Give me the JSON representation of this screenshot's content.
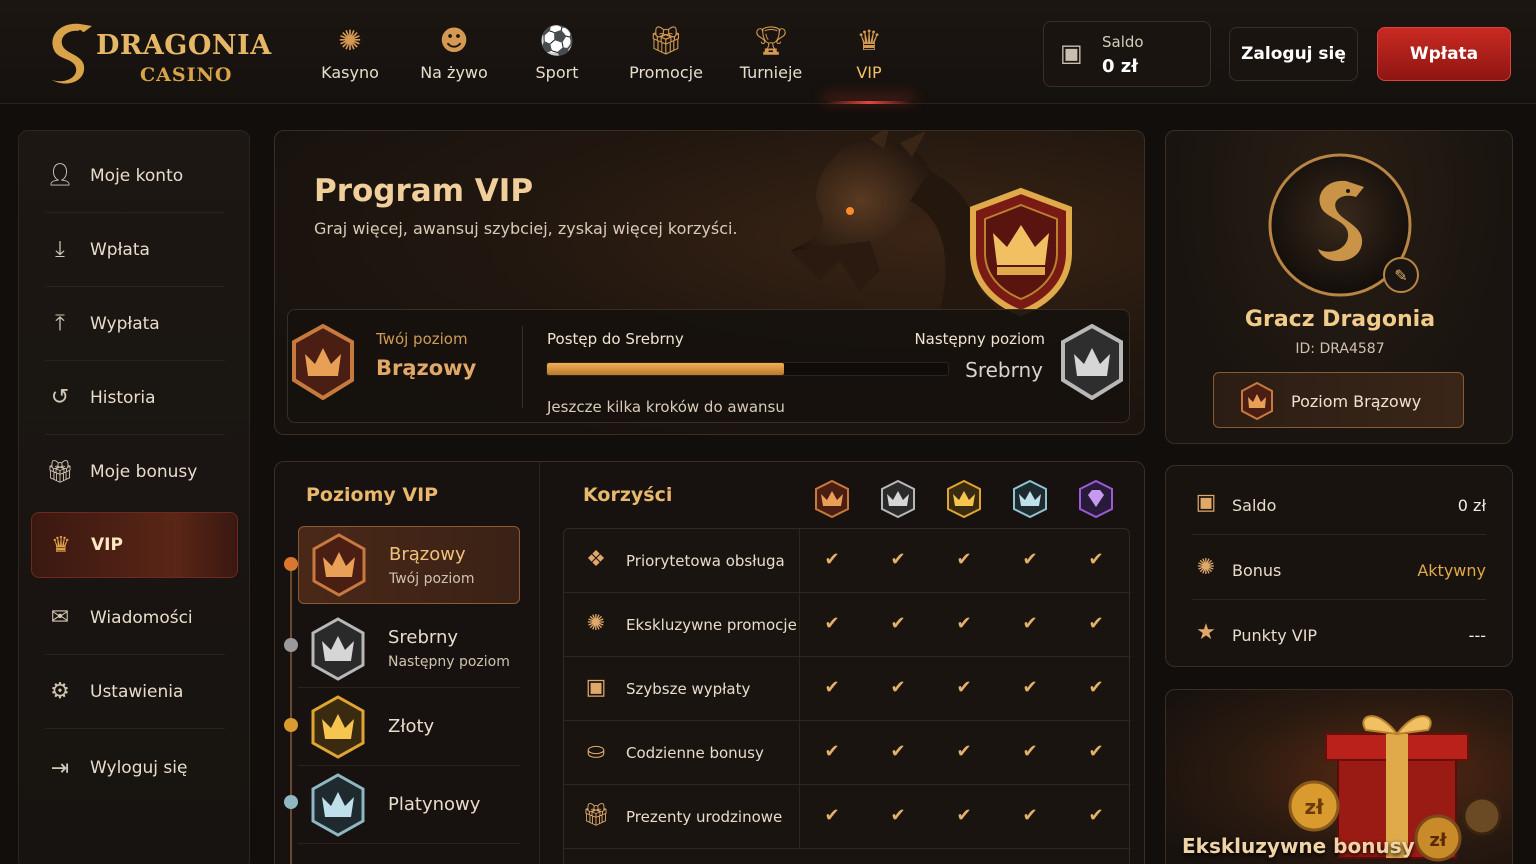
{
  "brand": {
    "name": "DRAGONIA",
    "sub": "CASINO"
  },
  "nav": {
    "items": [
      {
        "label": "Kasyno",
        "icon": "roulette-icon"
      },
      {
        "label": "Na żywo",
        "icon": "live-dealer-icon"
      },
      {
        "label": "Sport",
        "icon": "football-icon"
      },
      {
        "label": "Promocje",
        "icon": "gift-icon"
      },
      {
        "label": "Turnieje",
        "icon": "trophy-icon"
      },
      {
        "label": "VIP",
        "icon": "crown-icon",
        "active": true
      }
    ]
  },
  "header": {
    "balance_label": "Saldo",
    "balance_value": "0 zł",
    "login_label": "Zaloguj się",
    "deposit_label": "Wpłata"
  },
  "sidebar": {
    "items": [
      {
        "label": "Moje konto",
        "icon": "user-icon"
      },
      {
        "label": "Wpłata",
        "icon": "download-icon"
      },
      {
        "label": "Wypłata",
        "icon": "upload-icon"
      },
      {
        "label": "Historia",
        "icon": "history-icon"
      },
      {
        "label": "Moje bonusy",
        "icon": "gift-icon"
      },
      {
        "label": "VIP",
        "icon": "crown-icon",
        "active": true
      },
      {
        "label": "Wiadomości",
        "icon": "mail-icon"
      },
      {
        "label": "Ustawienia",
        "icon": "gear-icon"
      },
      {
        "label": "Wyloguj się",
        "icon": "logout-icon"
      }
    ]
  },
  "hero": {
    "title": "Program VIP",
    "subtitle": "Graj więcej, awansuj szybciej, zyskaj więcej korzyści.",
    "current_label": "Twój poziom",
    "current_level": "Brązowy",
    "progress_label": "Postęp do Srebrny",
    "progress": 0.59,
    "hint": "Jeszcze kilka kroków do awansu",
    "next_label": "Następny poziom",
    "next_level": "Srebrny"
  },
  "levels": {
    "title": "Poziomy VIP",
    "items": [
      {
        "name": "Brązowy",
        "sub": "Twój poziom",
        "color": "#c87a3e",
        "active": true
      },
      {
        "name": "Srebrny",
        "sub": "Następny poziom",
        "color": "#b8b8b8"
      },
      {
        "name": "Złoty",
        "sub": "",
        "color": "#e0a530"
      },
      {
        "name": "Platynowy",
        "sub": "",
        "color": "#8fb7c4"
      }
    ]
  },
  "benefits": {
    "title": "Korzyści",
    "tiers": [
      {
        "color": "#c87a3e",
        "icon": "bronze-crown-icon"
      },
      {
        "color": "#b8b8b8",
        "icon": "silver-crown-icon"
      },
      {
        "color": "#e0a530",
        "icon": "gold-crown-icon"
      },
      {
        "color": "#8fc4cf",
        "icon": "platinum-crown-icon"
      },
      {
        "color": "#9d5ad8",
        "icon": "diamond-icon"
      }
    ],
    "rows": [
      {
        "label": "Priorytetowa obsługa",
        "icon": "support-icon"
      },
      {
        "label": "Ekskluzywne promocje",
        "icon": "sparkle-icon"
      },
      {
        "label": "Szybsze wypłaty",
        "icon": "wallet-icon"
      },
      {
        "label": "Codzienne bonusy",
        "icon": "coins-icon"
      },
      {
        "label": "Prezenty urodzinowe",
        "icon": "gift-icon"
      }
    ],
    "check": "✔"
  },
  "profile": {
    "name": "Gracz Dragonia",
    "id": "ID: DRA4587",
    "level_label": "Poziom Brązowy"
  },
  "stats": {
    "rows": [
      {
        "label": "Saldo",
        "value": "0 zł",
        "icon": "wallet-icon"
      },
      {
        "label": "Bonus",
        "value": "Aktywny",
        "icon": "sparkle-icon",
        "accent": true
      },
      {
        "label": "Punkty VIP",
        "value": "---",
        "icon": "star-icon"
      }
    ]
  },
  "promo": {
    "title": "Ekskluzywne bonusy"
  },
  "colors": {
    "accent": "#e0a94a",
    "deposit": "#c92a22",
    "active_nav_glow": "#e2463a"
  }
}
